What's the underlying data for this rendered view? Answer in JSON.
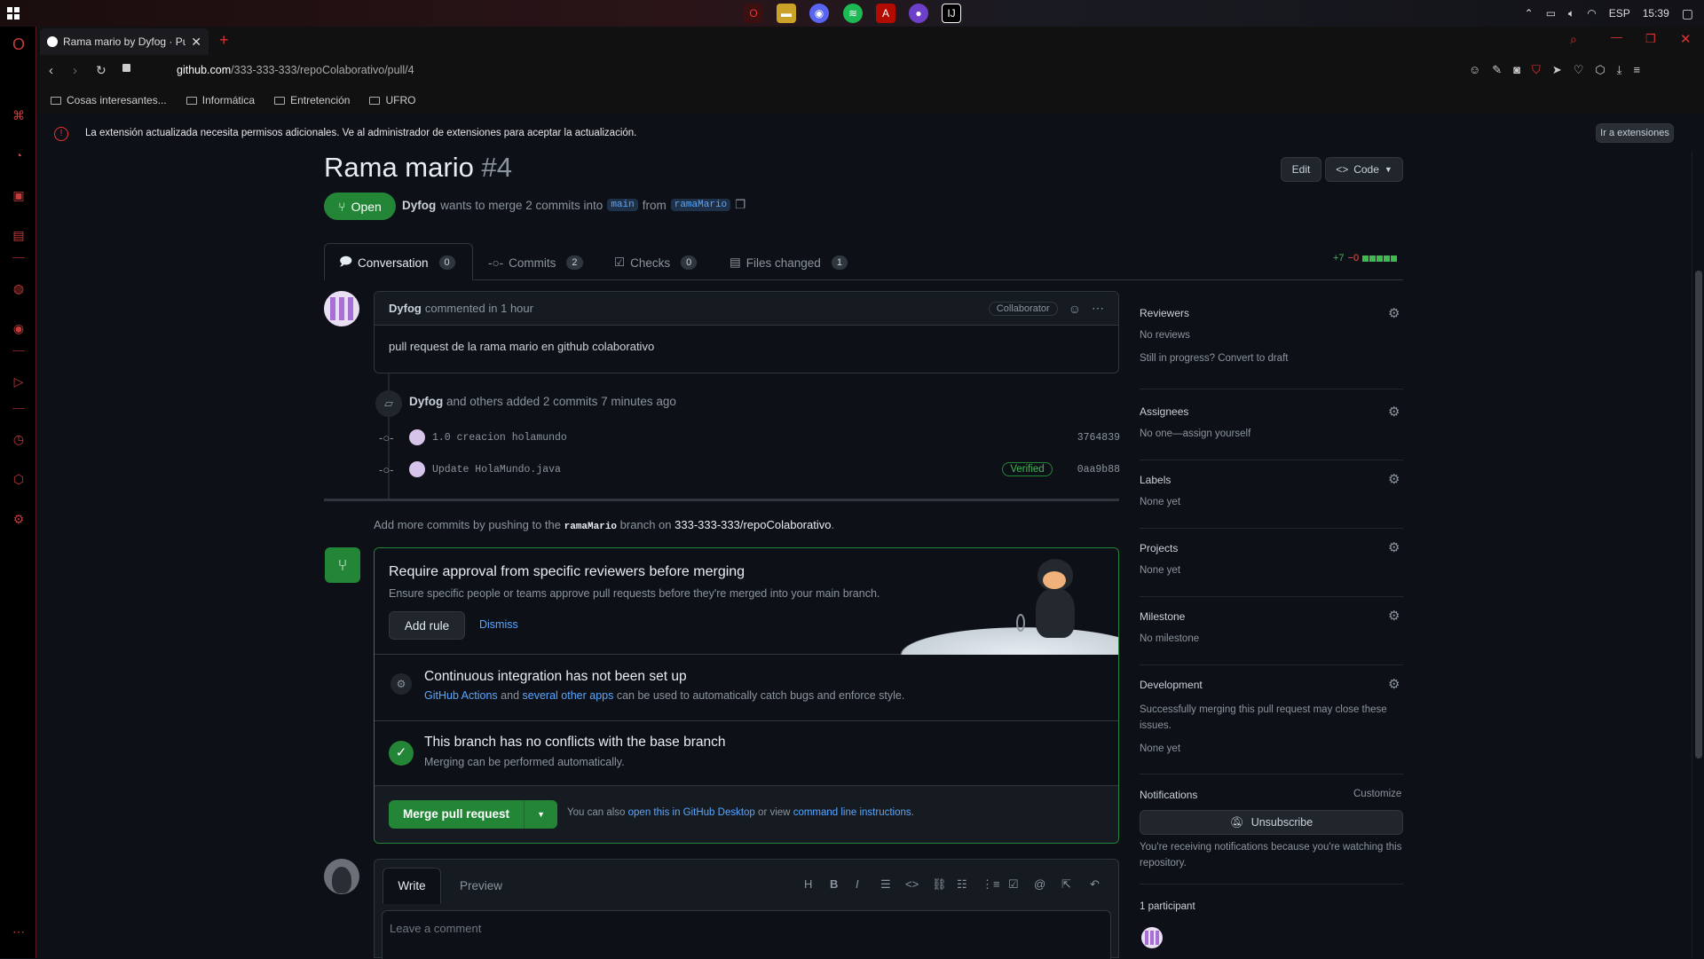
{
  "taskbar": {
    "language": "ESP",
    "time": "15:39"
  },
  "browser": {
    "tab_title": "Rama mario by Dyfog · Pul",
    "url_domain": "github.com",
    "url_path": "/333-333-333/repoColaborativo/pull/4",
    "bookmarks": [
      "Cosas interesantes...",
      "Informática",
      "Entretención",
      "UFRO"
    ],
    "infobar_text": "La extensión actualizada necesita permisos adicionales. Ve al administrador de extensiones para aceptar la actualización.",
    "infobar_button": "Ir a extensiones"
  },
  "pr": {
    "title": "Rama mario",
    "number": "#4",
    "state": "Open",
    "author": "Dyfog",
    "summary_mid": "wants to merge 2 commits into",
    "base_branch": "main",
    "from_label": "from",
    "head_branch": "ramaMario",
    "edit_label": "Edit",
    "code_label": "Code"
  },
  "tabs": [
    {
      "label": "Conversation",
      "count": "0"
    },
    {
      "label": "Commits",
      "count": "2"
    },
    {
      "label": "Checks",
      "count": "0"
    },
    {
      "label": "Files changed",
      "count": "1"
    }
  ],
  "diffstat": {
    "added": "+7",
    "removed": "−0"
  },
  "comment": {
    "author": "Dyfog",
    "meta": "commented in 1 hour",
    "badge": "Collaborator",
    "body": "pull request de la rama mario en github colaborativo"
  },
  "commits_event": {
    "author": "Dyfog",
    "text": "and others added 2 commits 7 minutes ago",
    "items": [
      {
        "message": "1.0 creacion holamundo",
        "sha": "3764839",
        "verified": ""
      },
      {
        "message": "Update HolaMundo.java",
        "sha": "0aa9b88",
        "verified": "Verified"
      }
    ]
  },
  "push_hint": {
    "prefix": "Add more commits by pushing to the",
    "branch": "ramaMario",
    "mid": "branch on",
    "repo": "333-333-333/repoColaborativo",
    "suffix": "."
  },
  "merge_box": {
    "rule_title": "Require approval from specific reviewers before merging",
    "rule_desc": "Ensure specific people or teams approve pull requests before they're merged into your main branch.",
    "add_rule": "Add rule",
    "dismiss": "Dismiss",
    "ci_title": "Continuous integration has not been set up",
    "ci_link1": "GitHub Actions",
    "ci_and": "and",
    "ci_link2": "several other apps",
    "ci_desc": "can be used to automatically catch bugs and enforce style.",
    "conflict_title": "This branch has no conflicts with the base branch",
    "conflict_desc": "Merging can be performed automatically.",
    "merge_button": "Merge pull request",
    "also_prefix": "You can also",
    "also_link1": "open this in GitHub Desktop",
    "also_mid": "or view",
    "also_link2": "command line instructions",
    "also_suffix": "."
  },
  "editor": {
    "write": "Write",
    "preview": "Preview",
    "placeholder": "Leave a comment"
  },
  "sidebar": {
    "reviewers_title": "Reviewers",
    "reviewers_val": "No reviews",
    "reviewers_hint": "Still in progress? Convert to draft",
    "assignees_title": "Assignees",
    "assignees_val": "No one—assign yourself",
    "labels_title": "Labels",
    "labels_val": "None yet",
    "projects_title": "Projects",
    "projects_val": "None yet",
    "milestone_title": "Milestone",
    "milestone_val": "No milestone",
    "development_title": "Development",
    "development_desc": "Successfully merging this pull request may close these issues.",
    "development_val": "None yet",
    "notifications_title": "Notifications",
    "customize": "Customize",
    "unsubscribe": "Unsubscribe",
    "notifications_desc": "You're receiving notifications because you're watching this repository.",
    "participants": "1 participant"
  },
  "colors": {
    "green": "#238636",
    "link": "#58a6ff",
    "opera_red": "#c43b3b"
  }
}
